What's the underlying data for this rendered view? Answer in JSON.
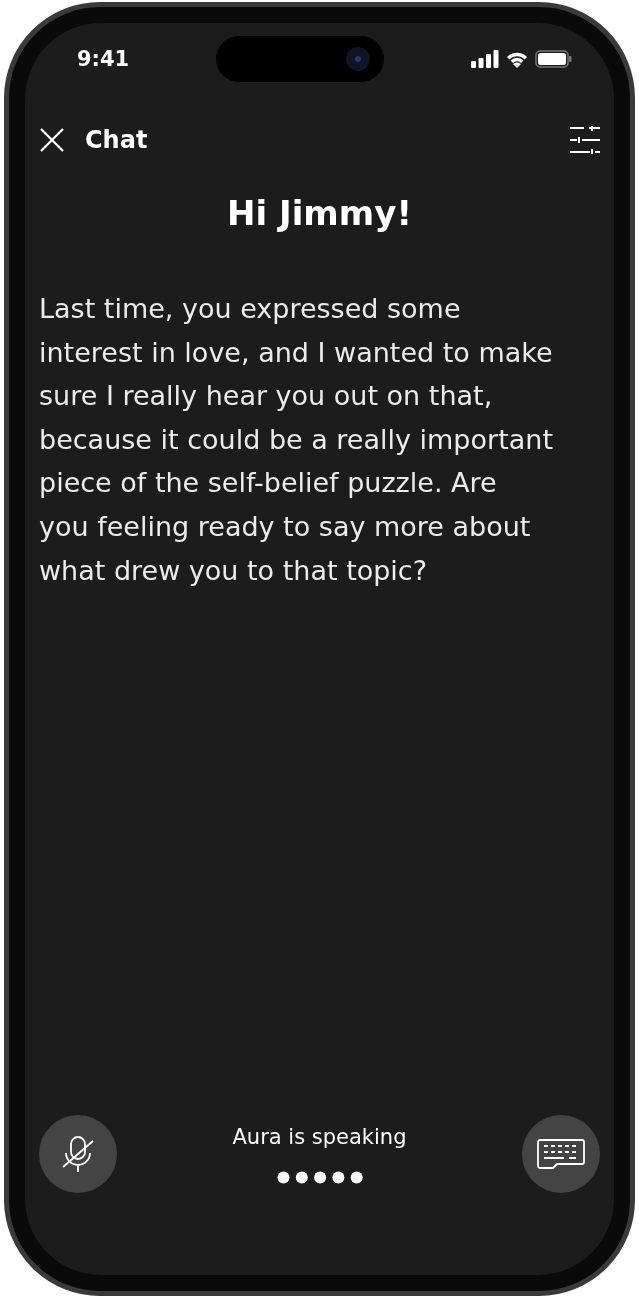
{
  "status_bar": {
    "time": "9:41"
  },
  "header": {
    "title": "Chat"
  },
  "greeting": "Hi Jimmy!",
  "message": "Last time, you expressed some interest in love, and I wanted to make sure I really hear you out on that, because it could be a really important piece of the self-belief puzzle. Are you feeling ready to say more about what drew you to that topic?",
  "footer": {
    "status": "Aura is speaking",
    "mic_muted": true
  }
}
